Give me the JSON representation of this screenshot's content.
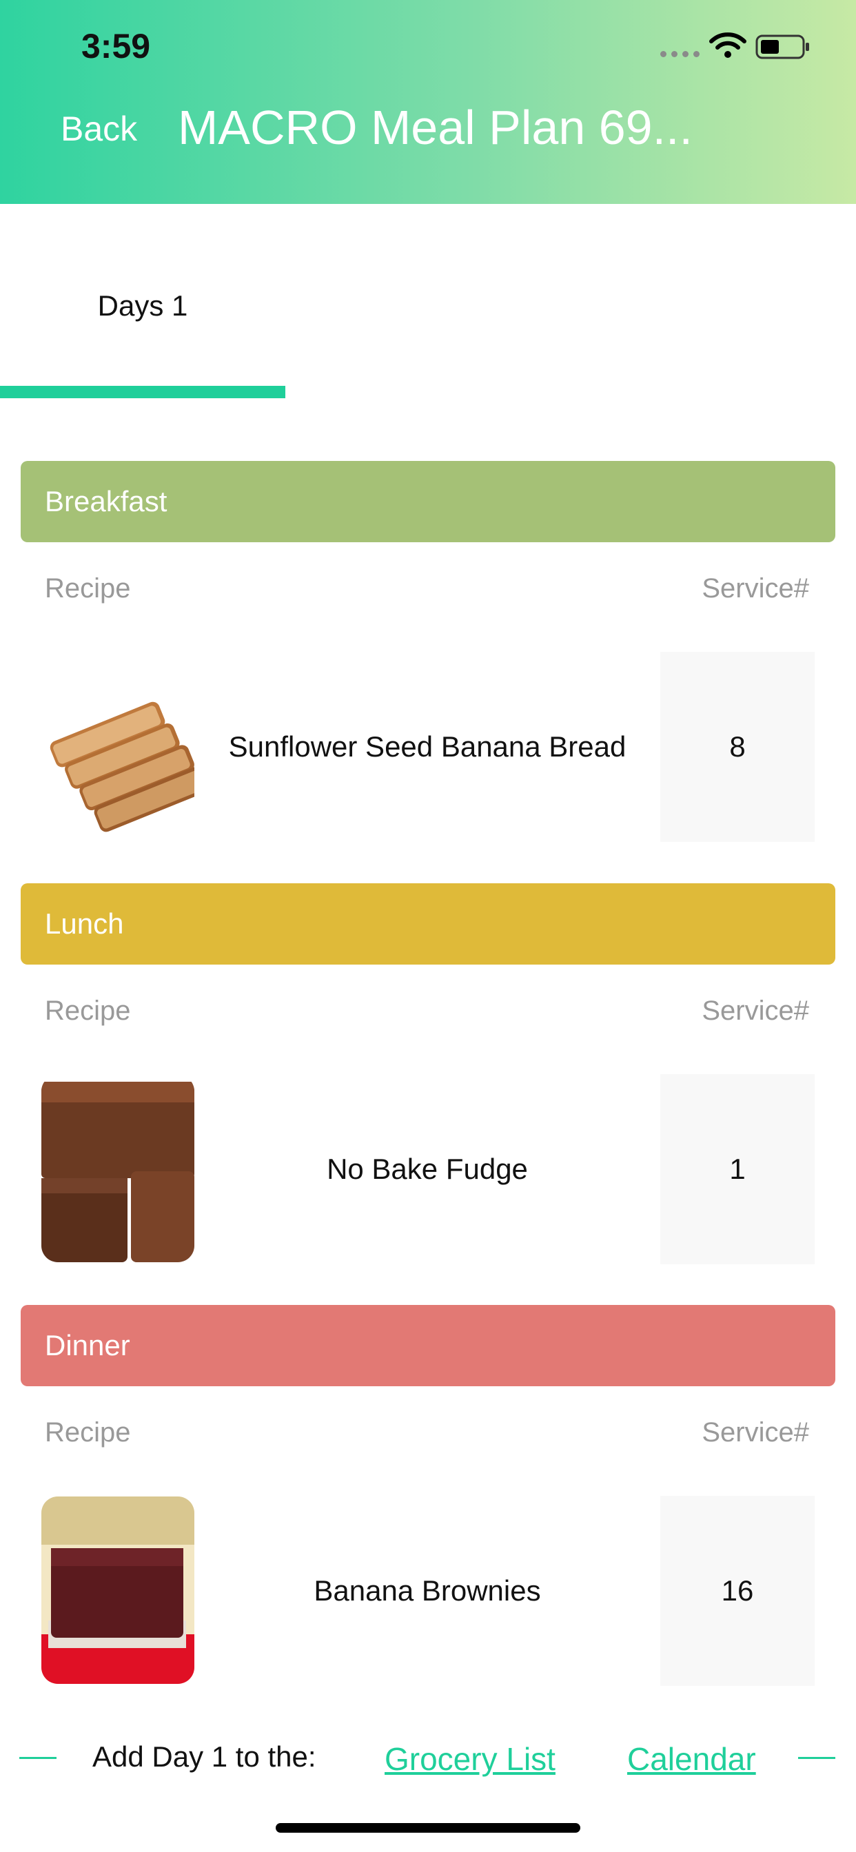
{
  "status_bar": {
    "time": "3:59"
  },
  "header": {
    "back_label": "Back",
    "title": "MACRO Meal Plan 69..."
  },
  "tabs": [
    {
      "label": "Days 1",
      "selected": true
    }
  ],
  "meals": [
    {
      "name": "Breakfast",
      "color": "#a5c176",
      "recipe_col": "Recipe",
      "service_col": "Service#",
      "recipe": {
        "title": "Sunflower Seed Banana Bread",
        "servings": "8"
      }
    },
    {
      "name": "Lunch",
      "color": "#dfba39",
      "recipe_col": "Recipe",
      "service_col": "Service#",
      "recipe": {
        "title": "No Bake Fudge",
        "servings": "1"
      }
    },
    {
      "name": "Dinner",
      "color": "#e27974",
      "recipe_col": "Recipe",
      "service_col": "Service#",
      "recipe": {
        "title": "Banana Brownies",
        "servings": "16"
      }
    }
  ],
  "footer": {
    "add_label": "Add Day 1 to the:",
    "grocery_link": "Grocery List",
    "calendar_link": "Calendar"
  },
  "colors": {
    "accent": "#1fcf9a",
    "header_start": "#2fd3a0",
    "header_end": "#c7e9a5"
  }
}
